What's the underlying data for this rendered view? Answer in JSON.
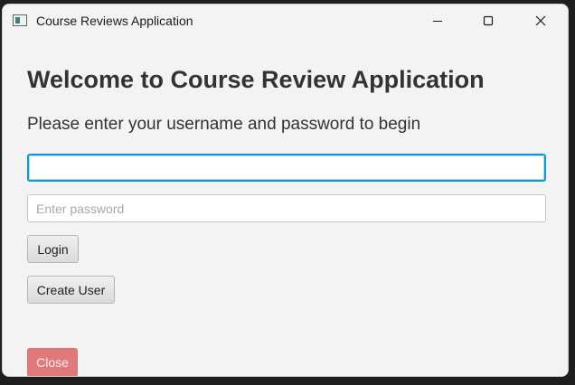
{
  "window": {
    "title": "Course Reviews Application"
  },
  "login": {
    "heading": "Welcome to Course Review Application",
    "subheading": "Please enter your username and password to begin",
    "username_value": "",
    "password_placeholder": "Enter password",
    "login_label": "Login",
    "create_user_label": "Create User",
    "close_label": "Close"
  },
  "colors": {
    "focus_border": "#0b9ad7",
    "close_button": "#e07a7a"
  },
  "icons": {
    "app": "app-window-icon",
    "minimize": "minimize-icon",
    "maximize": "maximize-icon",
    "close": "close-icon"
  }
}
